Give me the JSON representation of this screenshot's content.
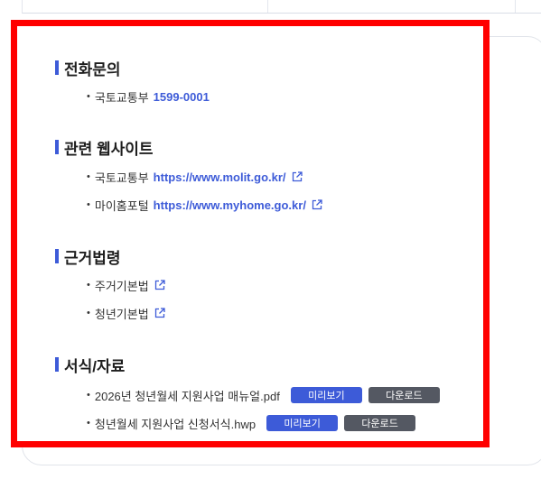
{
  "sections": [
    {
      "title": "전화문의",
      "items": [
        {
          "label": "국토교통부",
          "value": "1599-0001"
        }
      ]
    },
    {
      "title": "관련 웹사이트",
      "items": [
        {
          "label": "국토교통부",
          "value": "https://www.molit.go.kr/",
          "icon": "external-link-icon"
        },
        {
          "label": "마이홈포털",
          "value": "https://www.myhome.go.kr/",
          "icon": "external-link-icon"
        }
      ]
    },
    {
      "title": "근거법령",
      "items": [
        {
          "label": "주거기본법",
          "icon": "external-link-icon"
        },
        {
          "label": "청년기본법",
          "icon": "external-link-icon"
        }
      ]
    },
    {
      "title": "서식/자료",
      "items": [
        {
          "label": "2026년 청년월세 지원사업 매뉴얼.pdf",
          "preview": "미리보기",
          "download": "다운로드"
        },
        {
          "label": "청년월세 지원사업 신청서식.hwp",
          "preview": "미리보기",
          "download": "다운로드"
        }
      ]
    }
  ],
  "bullet": "•",
  "colors": {
    "accent": "#3d5bd8",
    "highlight_frame": "#ff0000",
    "download_button": "#545862"
  }
}
